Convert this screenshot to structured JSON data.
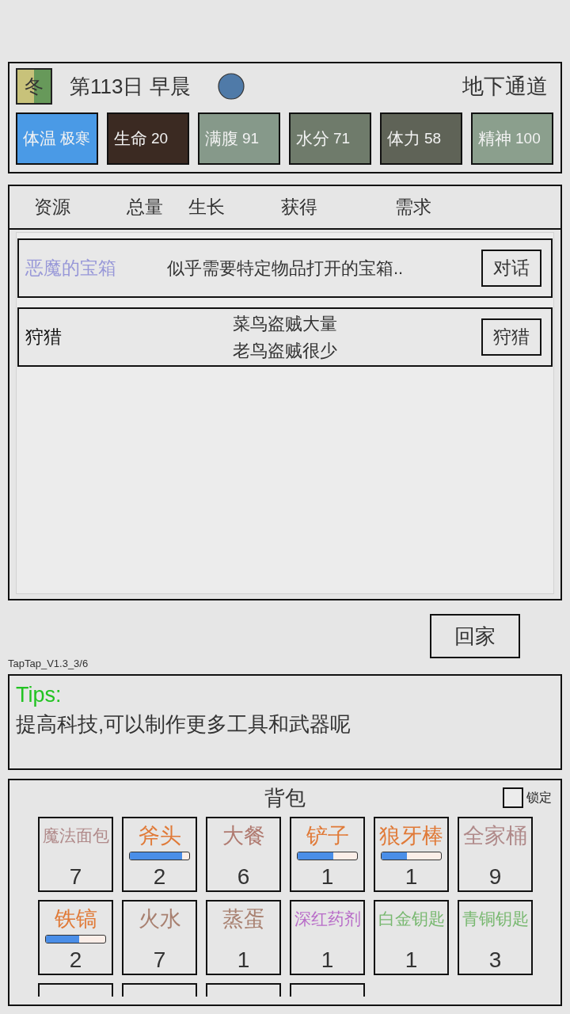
{
  "header": {
    "season": "冬",
    "day": "第113日 早晨",
    "location": "地下通道"
  },
  "stats": [
    {
      "label": "体温",
      "value": "极寒",
      "color": "#4a9ae6"
    },
    {
      "label": "生命",
      "value": "20",
      "color": "#3b2a22"
    },
    {
      "label": "满腹",
      "value": "91",
      "color": "#86998a"
    },
    {
      "label": "水分",
      "value": "71",
      "color": "#6f7b6b"
    },
    {
      "label": "体力",
      "value": "58",
      "color": "#5f6357"
    },
    {
      "label": "精神",
      "value": "100",
      "color": "#8b9f8d"
    }
  ],
  "resource_table": {
    "columns": [
      "资源",
      "总量",
      "生长",
      "获得",
      "需求"
    ],
    "rows": [
      {
        "title": "恶魔的宝箱",
        "color": "#9898d8",
        "description": [
          "似乎需要特定物品打开的宝箱.."
        ],
        "button": "对话"
      },
      {
        "title": "狩猎",
        "color": "#111111",
        "description": [
          "菜鸟盗贼大量",
          "老鸟盗贼很少"
        ],
        "button": "狩猎"
      }
    ]
  },
  "home_button": "回家",
  "version": "TapTap_V1.3_3/6",
  "tips": {
    "title": "Tips:",
    "text": "提高科技,可以制作更多工具和武器呢"
  },
  "backpack": {
    "title": "背包",
    "lock": {
      "label": "锁定",
      "checked": false
    },
    "items": [
      {
        "kind": "plain",
        "name": "魔法面包",
        "color": "#b08a8a",
        "count": "7"
      },
      {
        "kind": "tool",
        "name": "斧头",
        "color": "#e07a38",
        "level": 0.88,
        "count": "2"
      },
      {
        "kind": "plain",
        "name": "大餐",
        "color": "#b07a70",
        "count": "6"
      },
      {
        "kind": "tool",
        "name": "铲子",
        "color": "#e07a38",
        "level": 0.6,
        "count": "1"
      },
      {
        "kind": "tool",
        "name": "狼牙棒",
        "color": "#e07a38",
        "level": 0.43,
        "count": "1"
      },
      {
        "kind": "plain",
        "name": "全家桶",
        "color": "#b08a8a",
        "count": "9"
      },
      {
        "kind": "tool",
        "name": "铁镐",
        "color": "#e07a38",
        "level": 0.56,
        "count": "2"
      },
      {
        "kind": "plain",
        "name": "火水",
        "color": "#a88070",
        "count": "7"
      },
      {
        "kind": "plain",
        "name": "蒸蛋",
        "color": "#a88070",
        "count": "1"
      },
      {
        "kind": "plain",
        "name": "深红药剂",
        "color": "#b86cc8",
        "count": "1"
      },
      {
        "kind": "plain",
        "name": "白金钥匙",
        "color": "#78b870",
        "count": "1"
      },
      {
        "kind": "plain",
        "name": "青铜钥匙",
        "color": "#78b870",
        "count": "3"
      },
      {
        "kind": "clipped"
      },
      {
        "kind": "clipped"
      },
      {
        "kind": "clipped"
      },
      {
        "kind": "clipped"
      }
    ]
  }
}
